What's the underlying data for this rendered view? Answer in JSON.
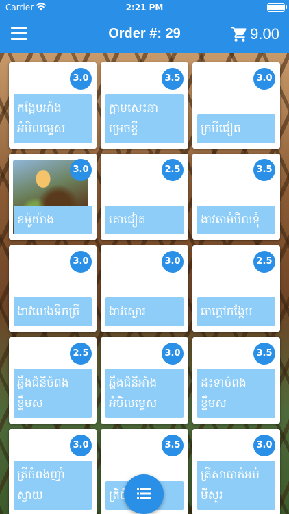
{
  "status_bar": {
    "carrier": "Carrier",
    "time": "2:21 PM"
  },
  "header": {
    "menu_icon": "hamburger-menu-icon",
    "title": "Order #: 29",
    "cart_icon": "shopping-cart-icon",
    "cart_total": "9.00"
  },
  "colors": {
    "primary": "#2a8fe6",
    "label_bg": "#8ecdf7"
  },
  "menu_items": [
    {
      "name": "កង្កែបអាំងអំបិលម្ទេស",
      "price": "3.0",
      "has_image": false
    },
    {
      "name": "ក្តាមសេះឆាម្រេចខ្ចី",
      "price": "3.5",
      "has_image": false
    },
    {
      "name": "ក្របីជៀត",
      "price": "3.0",
      "has_image": false
    },
    {
      "name": "ខម៉ូយ៉ាង",
      "price": "3.0",
      "has_image": true
    },
    {
      "name": "គោជៀត",
      "price": "2.5",
      "has_image": false
    },
    {
      "name": "ងាវឆាអំបិលទុំ",
      "price": "3.5",
      "has_image": false
    },
    {
      "name": "ងាវលេងទឹកត្រី",
      "price": "3.0",
      "has_image": false
    },
    {
      "name": "ងាវស្ងោរ",
      "price": "3.0",
      "has_image": false
    },
    {
      "name": "ឆាក្តៅកង្កែប",
      "price": "2.5",
      "has_image": false
    },
    {
      "name": "ឆ្អឹងជំនីចំពងខ្ទឹមស",
      "price": "2.5",
      "has_image": false
    },
    {
      "name": "ឆ្អឹងជំនីអាំងអំបិលម្ទេស",
      "price": "3.0",
      "has_image": false
    },
    {
      "name": "ដះទាចំពងខ្ទឹមស",
      "price": "3.5",
      "has_image": false
    },
    {
      "name": "ត្រីចំពងញាំស្វាយ",
      "price": "3.0",
      "has_image": false
    },
    {
      "name": "ត្រីចំពងលេ",
      "price": "3.5",
      "has_image": false
    },
    {
      "name": "ត្រីសាបាក់អប់មីសួរ",
      "price": "3.0",
      "has_image": false
    }
  ],
  "fab": {
    "icon": "list-icon"
  }
}
